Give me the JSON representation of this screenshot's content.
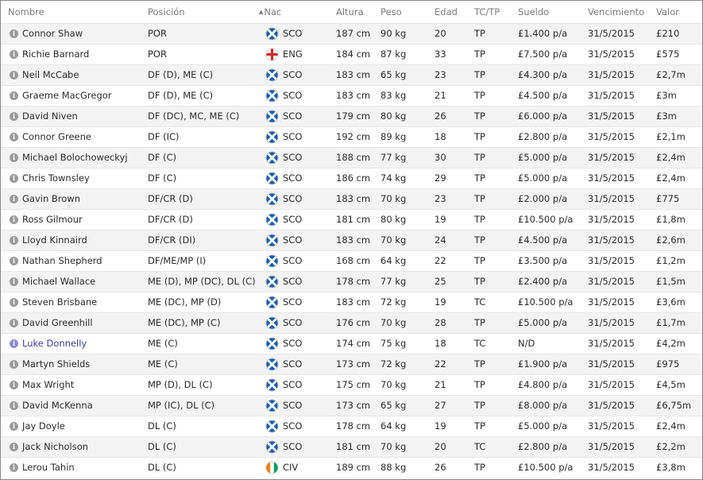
{
  "columns": {
    "nombre": "Nombre",
    "posicion": "Posición",
    "nac": "Nac",
    "altura": "Altura",
    "peso": "Peso",
    "edad": "Edad",
    "tctp": "TC/TP",
    "sueldo": "Sueldo",
    "vencimiento": "Vencimiento",
    "valor": "Valor"
  },
  "colors": {
    "highlight_name": "#3a3ab0",
    "row_alt": "#f3f3f3",
    "header_text": "#7b7b7b"
  },
  "players": [
    {
      "nombre": "Connor Shaw",
      "posicion": "POR",
      "flag": "scotland",
      "nac": "SCO",
      "altura": "187 cm",
      "peso": "90 kg",
      "edad": "20",
      "tctp": "TP",
      "sueldo": "£1.400 p/a",
      "vencimiento": "31/5/2015",
      "valor": "£210",
      "highlight": false
    },
    {
      "nombre": "Richie Barnard",
      "posicion": "POR",
      "flag": "england",
      "nac": "ENG",
      "altura": "184 cm",
      "peso": "87 kg",
      "edad": "33",
      "tctp": "TP",
      "sueldo": "£7.500 p/a",
      "vencimiento": "31/5/2015",
      "valor": "£575",
      "highlight": false
    },
    {
      "nombre": "Neil McCabe",
      "posicion": "DF (D), ME (C)",
      "flag": "scotland",
      "nac": "SCO",
      "altura": "183 cm",
      "peso": "65 kg",
      "edad": "23",
      "tctp": "TP",
      "sueldo": "£4.300 p/a",
      "vencimiento": "31/5/2015",
      "valor": "£2,7m",
      "highlight": false
    },
    {
      "nombre": "Graeme MacGregor",
      "posicion": "DF (D), ME (C)",
      "flag": "scotland",
      "nac": "SCO",
      "altura": "183 cm",
      "peso": "83 kg",
      "edad": "21",
      "tctp": "TP",
      "sueldo": "£4.500 p/a",
      "vencimiento": "31/5/2015",
      "valor": "£3m",
      "highlight": false
    },
    {
      "nombre": "David Niven",
      "posicion": "DF (DC), MC, ME (C)",
      "flag": "scotland",
      "nac": "SCO",
      "altura": "179 cm",
      "peso": "80 kg",
      "edad": "26",
      "tctp": "TP",
      "sueldo": "£6.000 p/a",
      "vencimiento": "31/5/2015",
      "valor": "£3m",
      "highlight": false
    },
    {
      "nombre": "Connor Greene",
      "posicion": "DF (IC)",
      "flag": "scotland",
      "nac": "SCO",
      "altura": "192 cm",
      "peso": "89 kg",
      "edad": "18",
      "tctp": "TP",
      "sueldo": "£2.800 p/a",
      "vencimiento": "31/5/2015",
      "valor": "£2,1m",
      "highlight": false
    },
    {
      "nombre": "Michael Bolochoweckyj",
      "posicion": "DF (C)",
      "flag": "scotland",
      "nac": "SCO",
      "altura": "188 cm",
      "peso": "77 kg",
      "edad": "30",
      "tctp": "TP",
      "sueldo": "£5.000 p/a",
      "vencimiento": "31/5/2015",
      "valor": "£2,4m",
      "highlight": false
    },
    {
      "nombre": "Chris Townsley",
      "posicion": "DF (C)",
      "flag": "scotland",
      "nac": "SCO",
      "altura": "186 cm",
      "peso": "74 kg",
      "edad": "29",
      "tctp": "TP",
      "sueldo": "£5.000 p/a",
      "vencimiento": "31/5/2015",
      "valor": "£2,4m",
      "highlight": false
    },
    {
      "nombre": "Gavin Brown",
      "posicion": "DF/CR (D)",
      "flag": "scotland",
      "nac": "SCO",
      "altura": "183 cm",
      "peso": "70 kg",
      "edad": "23",
      "tctp": "TP",
      "sueldo": "£2.000 p/a",
      "vencimiento": "31/5/2015",
      "valor": "£775",
      "highlight": false
    },
    {
      "nombre": "Ross Gilmour",
      "posicion": "DF/CR (D)",
      "flag": "scotland",
      "nac": "SCO",
      "altura": "181 cm",
      "peso": "80 kg",
      "edad": "19",
      "tctp": "TP",
      "sueldo": "£10.500 p/a",
      "vencimiento": "31/5/2015",
      "valor": "£1,8m",
      "highlight": false
    },
    {
      "nombre": "Lloyd Kinnaird",
      "posicion": "DF/CR (DI)",
      "flag": "scotland",
      "nac": "SCO",
      "altura": "183 cm",
      "peso": "70 kg",
      "edad": "24",
      "tctp": "TP",
      "sueldo": "£4.500 p/a",
      "vencimiento": "31/5/2015",
      "valor": "£2,6m",
      "highlight": false
    },
    {
      "nombre": "Nathan Shepherd",
      "posicion": "DF/ME/MP (I)",
      "flag": "scotland",
      "nac": "SCO",
      "altura": "168 cm",
      "peso": "64 kg",
      "edad": "22",
      "tctp": "TP",
      "sueldo": "£3.500 p/a",
      "vencimiento": "31/5/2015",
      "valor": "£1,2m",
      "highlight": false
    },
    {
      "nombre": "Michael Wallace",
      "posicion": "ME (D), MP (DC), DL (C)",
      "flag": "scotland",
      "nac": "SCO",
      "altura": "178 cm",
      "peso": "77 kg",
      "edad": "25",
      "tctp": "TP",
      "sueldo": "£2.400 p/a",
      "vencimiento": "31/5/2015",
      "valor": "£1,5m",
      "highlight": false
    },
    {
      "nombre": "Steven Brisbane",
      "posicion": "ME (DC), MP (D)",
      "flag": "scotland",
      "nac": "SCO",
      "altura": "183 cm",
      "peso": "72 kg",
      "edad": "19",
      "tctp": "TC",
      "sueldo": "£10.500 p/a",
      "vencimiento": "31/5/2015",
      "valor": "£3,6m",
      "highlight": false
    },
    {
      "nombre": "David Greenhill",
      "posicion": "ME (DC), MP (C)",
      "flag": "scotland",
      "nac": "SCO",
      "altura": "176 cm",
      "peso": "70 kg",
      "edad": "28",
      "tctp": "TP",
      "sueldo": "£5.000 p/a",
      "vencimiento": "31/5/2015",
      "valor": "£1,7m",
      "highlight": false
    },
    {
      "nombre": "Luke Donnelly",
      "posicion": "ME (C)",
      "flag": "scotland",
      "nac": "SCO",
      "altura": "174 cm",
      "peso": "75 kg",
      "edad": "18",
      "tctp": "TC",
      "sueldo": "N/D",
      "vencimiento": "31/5/2015",
      "valor": "£4,2m",
      "highlight": true
    },
    {
      "nombre": "Martyn Shields",
      "posicion": "ME (C)",
      "flag": "scotland",
      "nac": "SCO",
      "altura": "173 cm",
      "peso": "72 kg",
      "edad": "22",
      "tctp": "TP",
      "sueldo": "£1.900 p/a",
      "vencimiento": "31/5/2015",
      "valor": "£975",
      "highlight": false
    },
    {
      "nombre": "Max Wright",
      "posicion": "MP (D), DL (C)",
      "flag": "scotland",
      "nac": "SCO",
      "altura": "175 cm",
      "peso": "70 kg",
      "edad": "21",
      "tctp": "TP",
      "sueldo": "£4.800 p/a",
      "vencimiento": "31/5/2015",
      "valor": "£4,5m",
      "highlight": false
    },
    {
      "nombre": "David McKenna",
      "posicion": "MP (IC), DL (C)",
      "flag": "scotland",
      "nac": "SCO",
      "altura": "173 cm",
      "peso": "65 kg",
      "edad": "27",
      "tctp": "TP",
      "sueldo": "£8.000 p/a",
      "vencimiento": "31/5/2015",
      "valor": "£6,75m",
      "highlight": false
    },
    {
      "nombre": "Jay Doyle",
      "posicion": "DL (C)",
      "flag": "scotland",
      "nac": "SCO",
      "altura": "178 cm",
      "peso": "64 kg",
      "edad": "19",
      "tctp": "TP",
      "sueldo": "£5.000 p/a",
      "vencimiento": "31/5/2015",
      "valor": "£2,4m",
      "highlight": false
    },
    {
      "nombre": "Jack Nicholson",
      "posicion": "DL (C)",
      "flag": "scotland",
      "nac": "SCO",
      "altura": "181 cm",
      "peso": "70 kg",
      "edad": "20",
      "tctp": "TC",
      "sueldo": "£2.800 p/a",
      "vencimiento": "31/5/2015",
      "valor": "£2,2m",
      "highlight": false
    },
    {
      "nombre": "Lerou Tahin",
      "posicion": "DL (C)",
      "flag": "ivory-coast",
      "nac": "CIV",
      "altura": "189 cm",
      "peso": "88 kg",
      "edad": "26",
      "tctp": "TP",
      "sueldo": "£10.500 p/a",
      "vencimiento": "31/5/2015",
      "valor": "£3,8m",
      "highlight": false
    }
  ]
}
